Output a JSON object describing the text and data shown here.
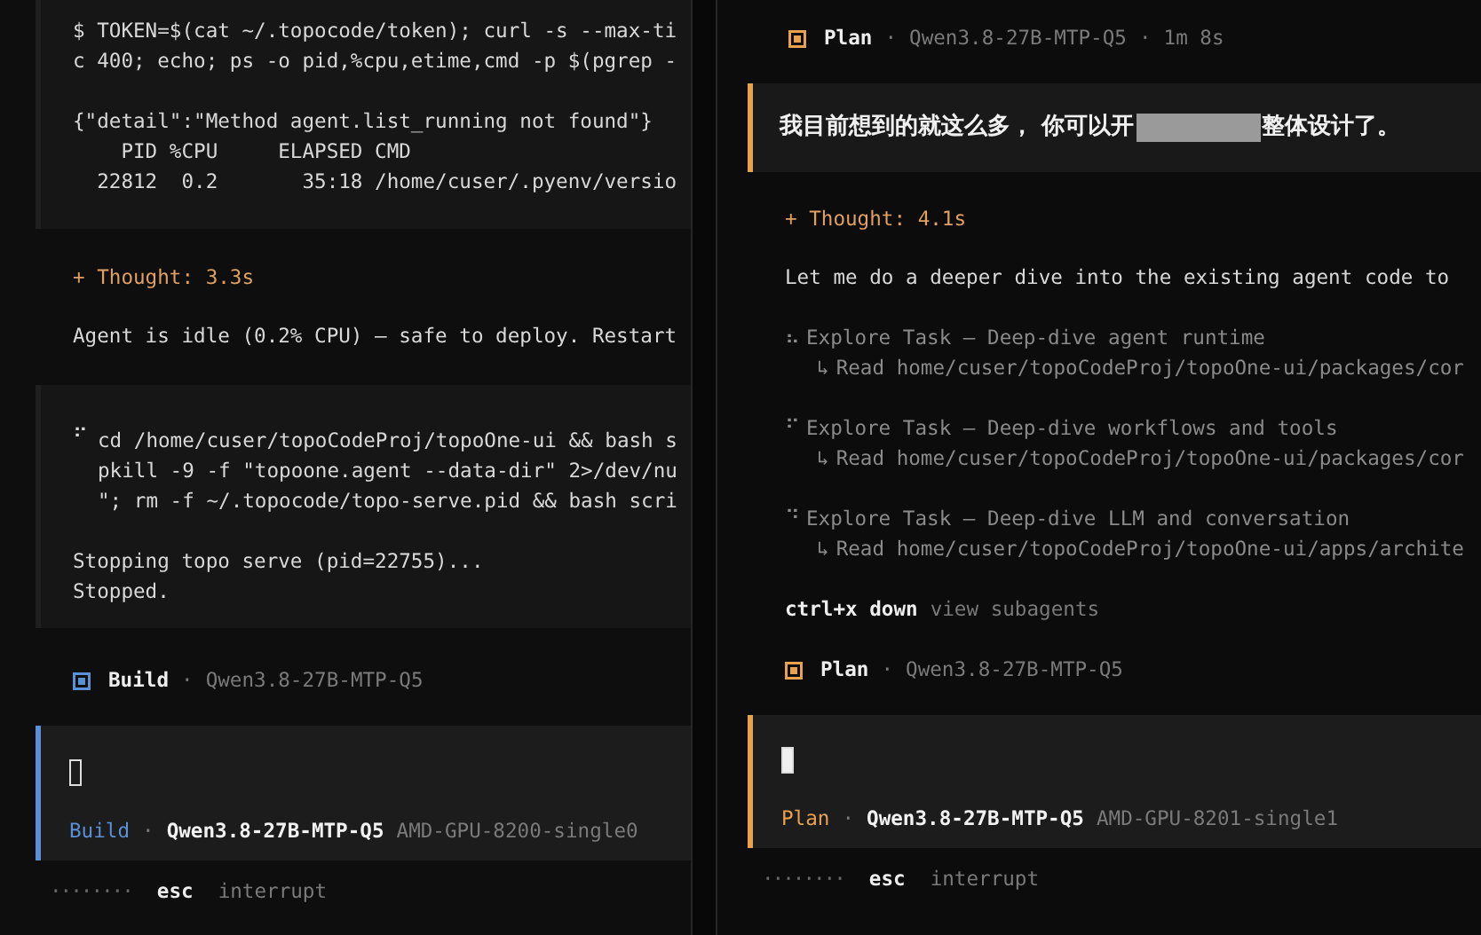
{
  "panes": [
    {
      "color": "#5b8fd6",
      "blocks": [
        {
          "kind": "output",
          "paragraphs": [
            [
              "$ TOKEN=$(cat ~/.topocode/token); curl -s --max-ti",
              "c 400; echo; ps -o pid,%cpu,etime,cmd -p $(pgrep -"
            ],
            [
              "{\"detail\":\"Method agent.list_running not found\"}",
              "    PID %CPU     ELAPSED CMD",
              "  22812  0.2       35:18 /home/cuser/.pyenv/versio"
            ]
          ]
        },
        {
          "kind": "thought",
          "text": "+ Thought: 3.3s"
        },
        {
          "kind": "text",
          "text": "Agent is idle (0.2% CPU) — safe to deploy. Restart"
        },
        {
          "kind": "command",
          "spinner": "⠋",
          "command_lines": [
            "cd /home/cuser/topoCodeProj/topoOne-ui && bash s",
            "pkill -9 -f \"topoone.agent --data-dir\" 2>/dev/nu",
            "\"; rm -f ~/.topocode/topo-serve.pid && bash scri"
          ],
          "output_lines": [
            "Stopping topo serve (pid=22755)...",
            "Stopped."
          ]
        },
        {
          "kind": "header",
          "agent": "Build",
          "separator": "·",
          "model": "Qwen3.8-27B-MTP-Q5"
        }
      ],
      "input": {
        "focused": false,
        "agent": "Build",
        "separator": "·",
        "model": "Qwen3.8-27B-MTP-Q5",
        "device": "AMD-GPU-8200-single0"
      },
      "status": {
        "spinner": "········",
        "key": "esc",
        "action": "interrupt"
      }
    },
    {
      "color": "#e8a24e",
      "blocks": [
        {
          "kind": "header",
          "agent": "Plan",
          "separator": "·",
          "model": "Qwen3.8-27B-MTP-Q5",
          "duration_separator": "·",
          "duration": "1m 8s"
        },
        {
          "kind": "user",
          "text_before": "我目前想到的就这么多， 你可以开",
          "text_after": "整体设计了。"
        },
        {
          "kind": "thought",
          "text": "+ Thought: 4.1s"
        },
        {
          "kind": "text",
          "text": "Let me do a deeper dive into the existing agent code to"
        },
        {
          "kind": "task",
          "spinner": "⠦",
          "title": "Explore Task — Deep-dive agent runtime",
          "detail_arrow": "↳",
          "detail": "Read home/cuser/topoCodeProj/topoOne-ui/packages/cor"
        },
        {
          "kind": "task",
          "spinner": "⠋",
          "title": "Explore Task — Deep-dive workflows and tools",
          "detail_arrow": "↳",
          "detail": "Read home/cuser/topoCodeProj/topoOne-ui/packages/cor"
        },
        {
          "kind": "task",
          "spinner": "⠙",
          "title": "Explore Task — Deep-dive LLM and conversation",
          "detail_arrow": "↳",
          "detail": "Read home/cuser/topoCodeProj/topoOne-ui/apps/archite"
        },
        {
          "kind": "hint",
          "key": "ctrl+x down",
          "action": "view subagents"
        },
        {
          "kind": "header",
          "agent": "Plan",
          "separator": "·",
          "model": "Qwen3.8-27B-MTP-Q5"
        }
      ],
      "input": {
        "focused": true,
        "agent": "Plan",
        "separator": "·",
        "model": "Qwen3.8-27B-MTP-Q5",
        "device": "AMD-GPU-8201-single1"
      },
      "status": {
        "spinner": "········",
        "key": "esc",
        "action": "interrupt"
      }
    }
  ]
}
